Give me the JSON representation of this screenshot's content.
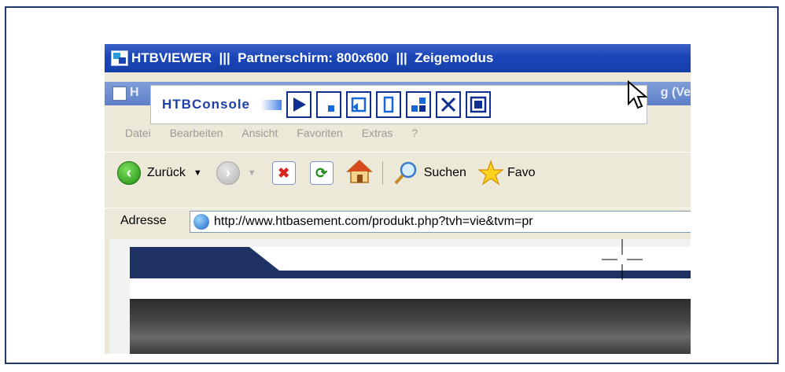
{
  "viewer": {
    "title": "HTBVIEWER  |||  Partnerschirm: 800x600  |||  Zeigemodus"
  },
  "ie": {
    "title_visible_start": "H",
    "title_visible_end": "g (Ve"
  },
  "console": {
    "logo": "HTBConsole",
    "buttons": [
      "play-icon",
      "stop-icon",
      "refresh-icon",
      "portrait-icon",
      "quadrant-icon",
      "close-icon",
      "exit-pointer-icon"
    ]
  },
  "menubar": {
    "items": [
      "Datei",
      "Bearbeiten",
      "Ansicht",
      "Favoriten",
      "Extras",
      "?"
    ]
  },
  "toolbar": {
    "back_label": "Zurück",
    "search_label": "Suchen",
    "favorites_label": "Favo"
  },
  "address": {
    "label": "Adresse",
    "url": "http://www.htbasement.com/produkt.php?tvh=vie&tvm=pr"
  },
  "colors": {
    "viewer_titlebar": "#1a45b8",
    "console_accent": "#0e2f8f",
    "site_navy": "#1d3163"
  }
}
